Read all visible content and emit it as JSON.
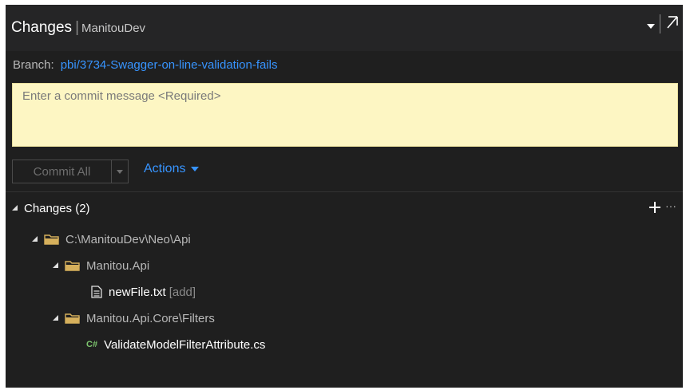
{
  "header": {
    "title": "Changes",
    "separator": "|",
    "repository": "ManitouDev"
  },
  "branch": {
    "label": "Branch:",
    "name": "pbi/3734-Swagger-on-line-validation-fails"
  },
  "commit_message": {
    "placeholder": "Enter a commit message <Required>",
    "value": ""
  },
  "commit_button": {
    "label": "Commit All"
  },
  "actions": {
    "label": "Actions"
  },
  "changes": {
    "header": "Changes (2)",
    "tree": [
      {
        "path": "C:\\ManitouDev\\Neo\\Api"
      },
      {
        "folder": "Manitou.Api"
      },
      {
        "file": "newFile.txt",
        "status": "[add]"
      },
      {
        "folder": "Manitou.Api.Core\\Filters"
      },
      {
        "file": "ValidateModelFilterAttribute.cs",
        "icon_text": "C#"
      }
    ]
  },
  "icons": {
    "dropdown": "chevron-down-icon",
    "popout": "pop-out-icon",
    "folder": "folder-icon",
    "text_file": "text-file-icon",
    "csharp_file": "csharp-file-icon",
    "add": "plus-icon",
    "more": "ellipsis-icon"
  },
  "colors": {
    "panel_bg": "#1f1f1f",
    "accent_link": "#3794ff",
    "commit_box_bg": "#fdf6c3",
    "folder": "#d6b05c",
    "csharp": "#7ec66f"
  }
}
